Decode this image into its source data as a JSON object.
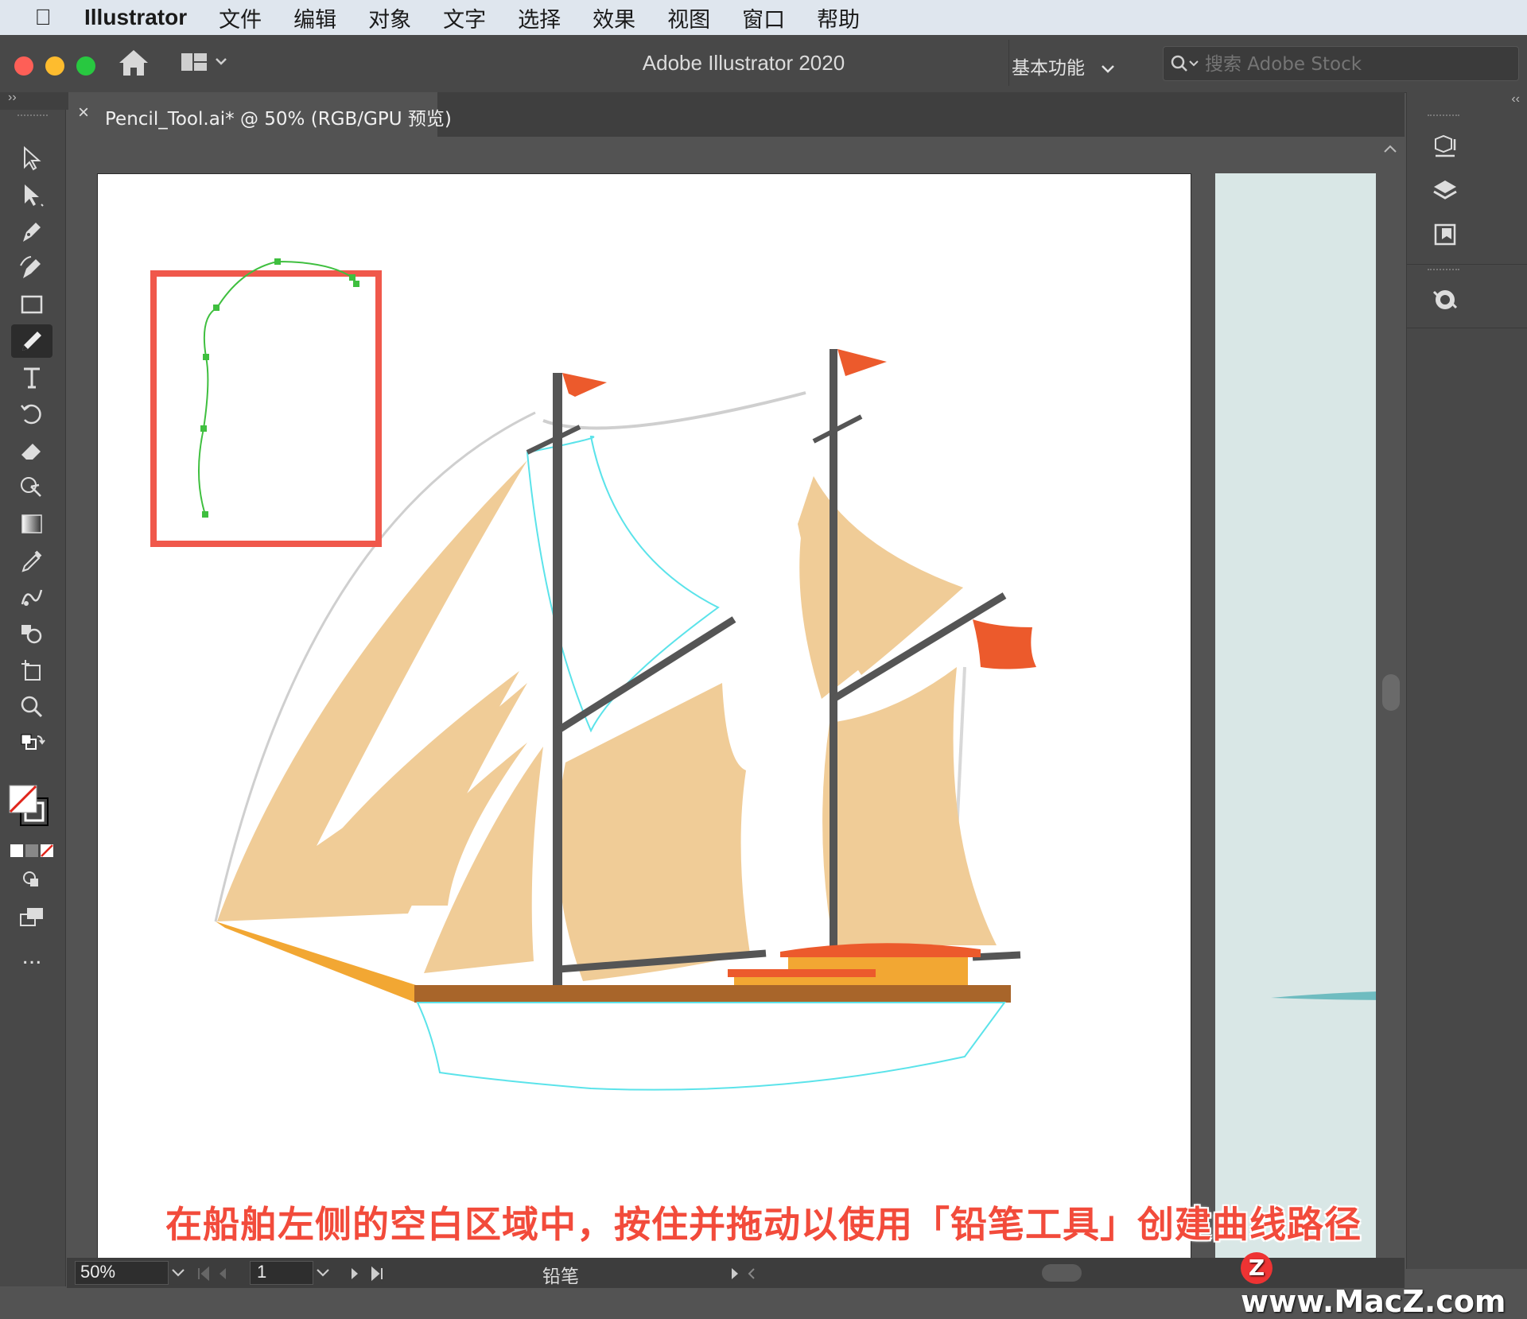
{
  "menubar": {
    "app_name": "Illustrator",
    "items": [
      "文件",
      "编辑",
      "对象",
      "文字",
      "选择",
      "效果",
      "视图",
      "窗口",
      "帮助"
    ]
  },
  "appbar": {
    "title": "Adobe Illustrator 2020",
    "workspace": "基本功能",
    "search_placeholder": "搜索 Adobe Stock"
  },
  "document_tab": {
    "close": "×",
    "label": "Pencil_Tool.ai* @ 50% (RGB/GPU 预览)"
  },
  "toolbar": {
    "tools": [
      "selection-tool",
      "direct-selection-tool",
      "pen-tool",
      "curvature-tool",
      "rectangle-tool",
      "pencil-tool",
      "type-tool",
      "rotate-tool",
      "eraser-tool",
      "shape-builder-tool",
      "gradient-tool",
      "eyedropper-tool",
      "blend-tool",
      "symbol-sprayer-tool",
      "artboard-tool",
      "zoom-tool"
    ],
    "active_tool": "pencil-tool",
    "more": "..."
  },
  "status_bar": {
    "zoom": "50%",
    "page": "1",
    "current_tool": "铅笔"
  },
  "caption": "在船舶左侧的空白区域中，按住并拖动以使用「铅笔工具」创建曲线路径",
  "watermark": "www.MacZ.com",
  "colors": {
    "highlight_box": "#f0584b",
    "pencil_path": "#3fbf3f",
    "sail": "#f0cc97",
    "flag": "#ec5a2c",
    "selection_outline": "#5be3ea",
    "mast": "#555555",
    "hull_deck": "#a8652a",
    "cabin": "#f2a733"
  }
}
